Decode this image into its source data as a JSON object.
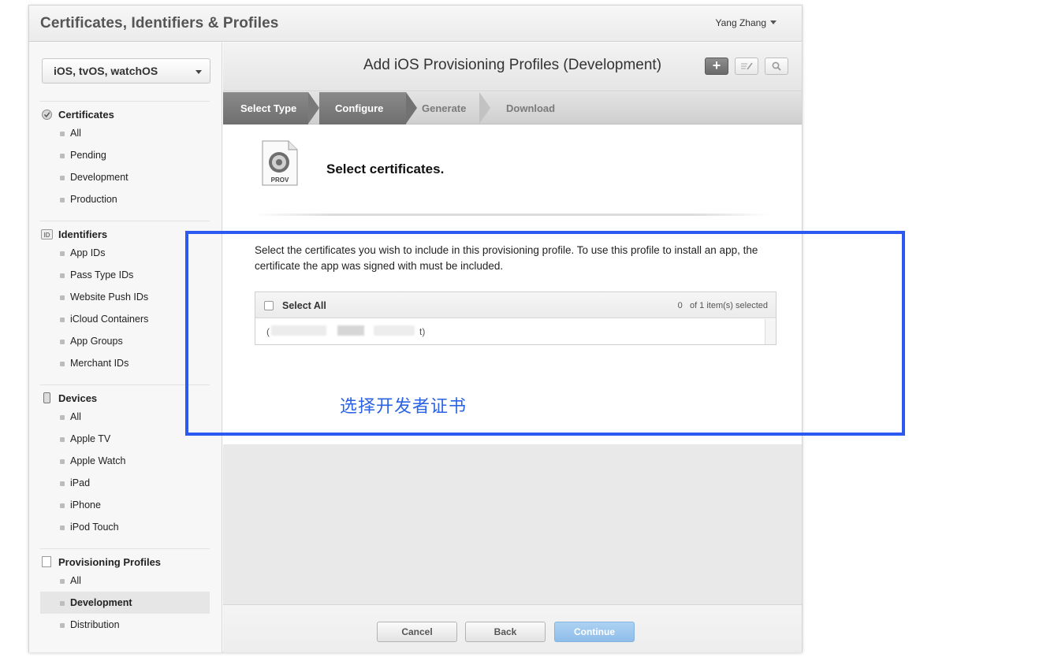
{
  "header": {
    "app_title": "Certificates, Identifiers & Profiles",
    "user_name": "Yang Zhang"
  },
  "sidebar": {
    "platform": "iOS, tvOS, watchOS",
    "sections": [
      {
        "title": "Certificates",
        "icon": "certificate-icon",
        "items": [
          "All",
          "Pending",
          "Development",
          "Production"
        ]
      },
      {
        "title": "Identifiers",
        "icon": "id-icon",
        "icon_text": "ID",
        "items": [
          "App IDs",
          "Pass Type IDs",
          "Website Push IDs",
          "iCloud Containers",
          "App Groups",
          "Merchant IDs"
        ]
      },
      {
        "title": "Devices",
        "icon": "device-icon",
        "items": [
          "All",
          "Apple TV",
          "Apple Watch",
          "iPad",
          "iPhone",
          "iPod Touch"
        ]
      },
      {
        "title": "Provisioning Profiles",
        "icon": "document-icon",
        "items": [
          "All",
          "Development",
          "Distribution"
        ],
        "active_item": "Development"
      }
    ]
  },
  "main": {
    "title": "Add iOS Provisioning Profiles (Development)",
    "toolbar": {
      "add_icon": "plus-icon",
      "edit_icon": "edit-icon",
      "search_icon": "search-icon"
    },
    "steps": [
      {
        "label": "Select Type",
        "state": "done"
      },
      {
        "label": "Configure",
        "state": "current"
      },
      {
        "label": "Generate",
        "state": "pending"
      },
      {
        "label": "Download",
        "state": "pending"
      }
    ],
    "prov_icon_label": "PROV",
    "section_title": "Select certificates.",
    "description": "Select the certificates you wish to include in this provisioning profile. To use this profile to install an app, the certificate the app was signed with must be included.",
    "table": {
      "select_all_label": "Select All",
      "selected_count": "0",
      "selected_suffix": "of 1 item(s) selected",
      "rows": [
        {
          "name_visible_fragment": "(",
          "name_visible_tail": "t)"
        }
      ]
    },
    "annotation": "选择开发者证书",
    "footer": {
      "cancel": "Cancel",
      "back": "Back",
      "continue": "Continue"
    }
  },
  "colors": {
    "highlight": "#2c59f0",
    "annotation_text": "#2b63e6",
    "continue_button": "#9cc7ef",
    "step_done": "#7c7c7c"
  }
}
